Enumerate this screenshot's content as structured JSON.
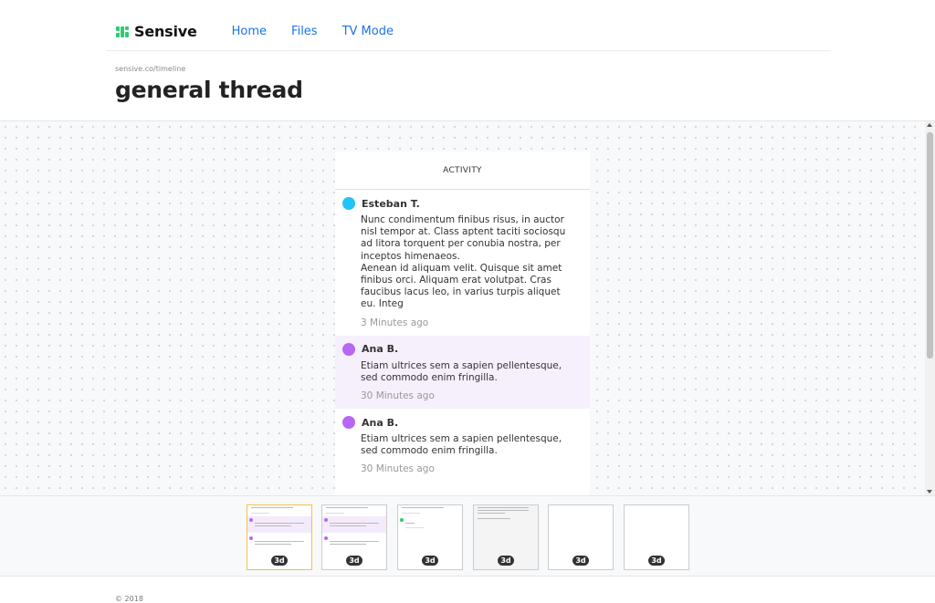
{
  "app": {
    "logo_text": "Sensive",
    "logo_color": "#2ecc71",
    "nav": [
      {
        "label": "Home"
      },
      {
        "label": "Files"
      },
      {
        "label": "TV Mode"
      }
    ]
  },
  "page": {
    "breadcrumb": "sensive.co/timeline",
    "title": "general thread"
  },
  "activity": {
    "header": "ACTIVITY",
    "entries": [
      {
        "author": "Esteban T.",
        "color": "#22c4f5",
        "body": "Nunc condimentum finibus risus, in auctor nisl tempor at. Class aptent taciti sociosqu ad litora torquent per conubia nostra, per inceptos himenaeos.\nAenean id aliquam velit. Quisque sit amet finibus orci. Aliquam erat volutpat. Cras faucibus lacus leo, in varius turpis aliquet eu. Integ",
        "time": "3 Minutes ago"
      },
      {
        "author": "Ana B.",
        "color": "#b866f5",
        "body": "Etiam ultrices sem a sapien pellentesque, sed commodo enim fringilla.",
        "time": "30 Minutes ago"
      },
      {
        "author": "Ana B.",
        "color": "#b866f5",
        "body": "Etiam ultrices sem a sapien pellentesque, sed commodo enim fringilla.",
        "time": "30 Minutes ago"
      }
    ]
  },
  "thumbnails": [
    {
      "badge": "3d",
      "active": true
    },
    {
      "badge": "3d",
      "active": false
    },
    {
      "badge": "3d",
      "active": false
    },
    {
      "badge": "3d",
      "active": false
    },
    {
      "badge": "3d",
      "active": false
    },
    {
      "badge": "3d",
      "active": false
    }
  ],
  "footer": {
    "copyright": "© 2018"
  }
}
